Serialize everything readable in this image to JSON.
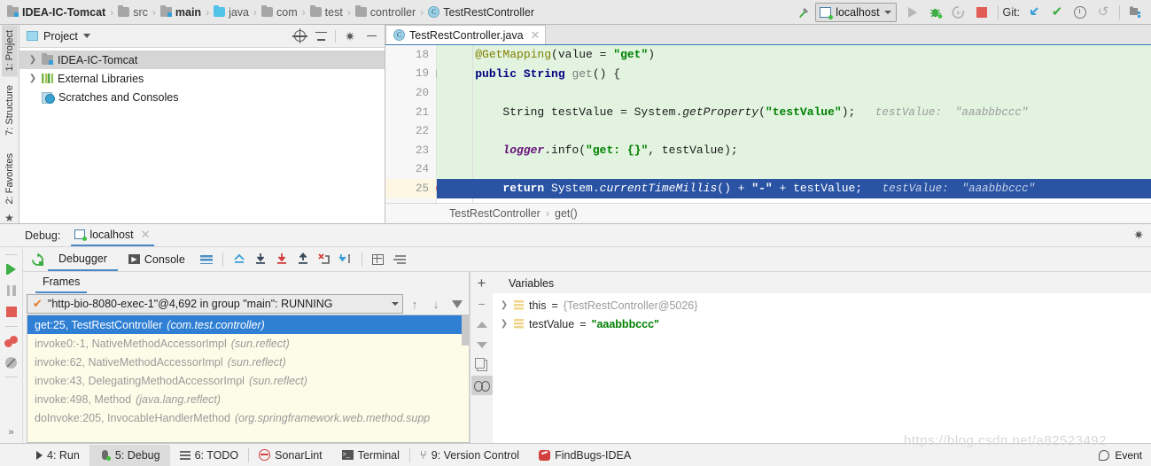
{
  "toolbar": {
    "breadcrumbs": [
      {
        "label": "IDEA-IC-Tomcat",
        "icon": "module-icon",
        "style": "bold"
      },
      {
        "label": "src",
        "icon": "folder-icon",
        "style": "dim"
      },
      {
        "label": "main",
        "icon": "module-icon",
        "style": "bold"
      },
      {
        "label": "java",
        "icon": "folder-blue-icon",
        "style": "dim"
      },
      {
        "label": "com",
        "icon": "folder-icon",
        "style": "dim"
      },
      {
        "label": "test",
        "icon": "folder-icon",
        "style": "dim"
      },
      {
        "label": "controller",
        "icon": "folder-icon",
        "style": "dim"
      },
      {
        "label": "TestRestController",
        "icon": "class-icon",
        "style": "normal"
      }
    ],
    "separator": "›",
    "run_config": "localhost",
    "git_label": "Git:",
    "icons": [
      "hammer-icon",
      "run-icon",
      "debug-icon",
      "rerun-icon",
      "stop-icon",
      "update-project-icon",
      "commit-icon",
      "history-icon",
      "rollback-icon",
      "project-structure-icon"
    ]
  },
  "project_panel": {
    "title": "Project",
    "tree": [
      {
        "label": "IDEA-IC-Tomcat",
        "icon": "module-icon",
        "expandable": true,
        "selected": true
      },
      {
        "label": "External Libraries",
        "icon": "library-icon",
        "expandable": true,
        "selected": false
      },
      {
        "label": "Scratches and Consoles",
        "icon": "scratch-icon",
        "expandable": false,
        "selected": false
      }
    ],
    "header_icons": [
      "locate-icon",
      "collapse-all-icon",
      "settings-gear-icon",
      "hide-icon"
    ]
  },
  "vertical_tabs": [
    {
      "label": "1: Project",
      "num": "1",
      "active": true
    },
    {
      "label": "7: Structure",
      "num": "7",
      "active": false
    },
    {
      "label": "2: Favorites",
      "num": "2",
      "active": false
    }
  ],
  "editor": {
    "tab": {
      "label": "TestRestController.java",
      "icon": "class-icon"
    },
    "lines": [
      {
        "num": "18",
        "exec": true,
        "current": false,
        "hint": "",
        "tokens": [
          {
            "t": "    ",
            "c": "plain"
          },
          {
            "t": "@GetMapping",
            "c": "anno"
          },
          {
            "t": "(value = ",
            "c": "plain"
          },
          {
            "t": "\"get\"",
            "c": "str"
          },
          {
            "t": ")",
            "c": "plain"
          }
        ]
      },
      {
        "num": "19",
        "exec": true,
        "current": false,
        "hint": "",
        "tokens": [
          {
            "t": "    ",
            "c": "plain"
          },
          {
            "t": "public ",
            "c": "kw"
          },
          {
            "t": "String ",
            "c": "kw"
          },
          {
            "t": "get",
            "c": "meth"
          },
          {
            "t": "() {",
            "c": "plain"
          }
        ]
      },
      {
        "num": "20",
        "exec": true,
        "current": false,
        "hint": "",
        "tokens": []
      },
      {
        "num": "21",
        "exec": true,
        "current": false,
        "hint": "testValue:  \"aaabbbccc\"",
        "tokens": [
          {
            "t": "        String testValue = System.",
            "c": "plain"
          },
          {
            "t": "getProperty",
            "c": "ital"
          },
          {
            "t": "(",
            "c": "plain"
          },
          {
            "t": "\"testValue\"",
            "c": "str"
          },
          {
            "t": ");",
            "c": "plain"
          }
        ]
      },
      {
        "num": "22",
        "exec": true,
        "current": false,
        "hint": "",
        "tokens": []
      },
      {
        "num": "23",
        "exec": true,
        "current": false,
        "hint": "",
        "tokens": [
          {
            "t": "        ",
            "c": "plain"
          },
          {
            "t": "logger",
            "c": "fld"
          },
          {
            "t": ".info(",
            "c": "plain"
          },
          {
            "t": "\"get: {}\"",
            "c": "str"
          },
          {
            "t": ", testValue);",
            "c": "plain"
          }
        ]
      },
      {
        "num": "24",
        "exec": true,
        "current": false,
        "hint": "",
        "tokens": []
      },
      {
        "num": "25",
        "exec": false,
        "current": true,
        "breakpoint": true,
        "hint": "testValue:  \"aaabbbccc\"",
        "tokens": [
          {
            "t": "        ",
            "c": "plain"
          },
          {
            "t": "return ",
            "c": "kw"
          },
          {
            "t": "System.",
            "c": "plain"
          },
          {
            "t": "currentTimeMillis",
            "c": "ital"
          },
          {
            "t": "() + ",
            "c": "plain"
          },
          {
            "t": "\"-\"",
            "c": "str"
          },
          {
            "t": " + testValue;",
            "c": "plain"
          }
        ]
      }
    ],
    "breadcrumb": [
      "TestRestController",
      "get()"
    ],
    "breadcrumb_sep": "›"
  },
  "debug": {
    "title_label": "Debug:",
    "session_tab": "localhost",
    "tabs": [
      {
        "label": "Debugger",
        "icon": "debugger-icon",
        "active": true
      },
      {
        "label": "Console",
        "icon": "console-icon",
        "active": false
      }
    ],
    "toolbar_icons": [
      "mute-breakpoints-icon",
      "show-execution-point-icon",
      "step-over-icon",
      "step-into-icon",
      "force-step-into-icon",
      "step-out-icon",
      "drop-frame-icon",
      "run-to-cursor-icon",
      "evaluate-expression-icon",
      "sort-icon"
    ],
    "left_strip_icons": [
      "resume-program-icon",
      "pause-program-icon",
      "stop-icon",
      "view-breakpoints-icon",
      "mute-breakpoints-icon",
      "more-icon"
    ],
    "frames": {
      "tab_label": "Frames",
      "thread": "\"http-bio-8080-exec-1\"@4,692 in group \"main\": RUNNING",
      "items": [
        {
          "method": "get:25, TestRestController",
          "pkg": "(com.test.controller)",
          "selected": true
        },
        {
          "method": "invoke0:-1, NativeMethodAccessorImpl",
          "pkg": "(sun.reflect)",
          "selected": false
        },
        {
          "method": "invoke:62, NativeMethodAccessorImpl",
          "pkg": "(sun.reflect)",
          "selected": false
        },
        {
          "method": "invoke:43, DelegatingMethodAccessorImpl",
          "pkg": "(sun.reflect)",
          "selected": false
        },
        {
          "method": "invoke:498, Method",
          "pkg": "(java.lang.reflect)",
          "selected": false
        },
        {
          "method": "doInvoke:205, InvocableHandlerMethod",
          "pkg": "(org.springframework.web.method.supp",
          "selected": false
        }
      ],
      "right_icons": [
        "add-icon",
        "remove-icon",
        "move-up-icon",
        "move-down-icon",
        "copy-icon",
        "inspect-icon"
      ]
    },
    "variables": {
      "tab_label": "Variables",
      "items": [
        {
          "name": "this",
          "eq": "=",
          "value": "{TestRestController@5026}",
          "value_type": "object"
        },
        {
          "name": "testValue",
          "eq": "=",
          "value": "\"aaabbbccc\"",
          "value_type": "string"
        }
      ]
    }
  },
  "status_bar": {
    "items": [
      {
        "label": "4: Run",
        "num": "4",
        "icon": "run-icon",
        "active": false
      },
      {
        "label": "5: Debug",
        "num": "5",
        "icon": "debug-icon",
        "active": true
      },
      {
        "label": "6: TODO",
        "num": "6",
        "icon": "todo-icon",
        "active": false
      },
      {
        "label": "SonarLint",
        "num": "",
        "icon": "sonarlint-icon",
        "active": false
      },
      {
        "label": "Terminal",
        "num": "",
        "icon": "terminal-icon",
        "active": false
      },
      {
        "label": "9: Version Control",
        "num": "9",
        "icon": "vcs-icon",
        "active": false
      },
      {
        "label": "FindBugs-IDEA",
        "num": "",
        "icon": "findbugs-icon",
        "active": false
      }
    ],
    "event_label": "Event"
  },
  "watermark": "https://blog.csdn.net/a82523492"
}
